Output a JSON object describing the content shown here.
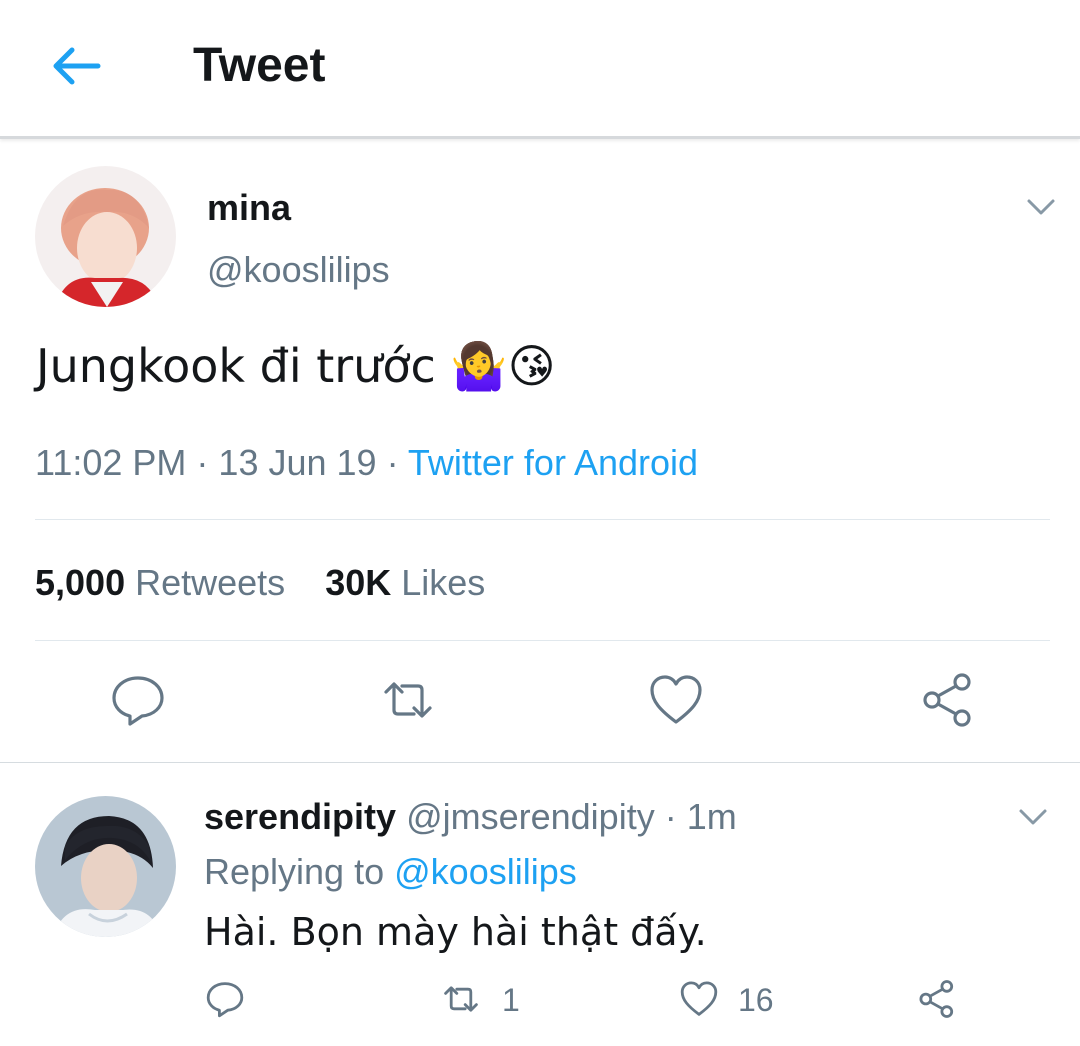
{
  "header": {
    "title": "Tweet"
  },
  "tweet": {
    "name": "mina",
    "handle": "@kooslilips",
    "text": "Jungkook đi trước 🤷‍♀️😘",
    "time": "11:02 PM",
    "date": "13 Jun 19",
    "separator": " · ",
    "source": "Twitter for Android",
    "retweets_count": "5,000",
    "retweets_label": "Retweets",
    "likes_count": "30K",
    "likes_label": "Likes"
  },
  "reply": {
    "name": "serendipity",
    "handle": "@jmserendipity",
    "time": "1m",
    "replying_prefix": "Replying to",
    "replying_handle": "@kooslilips",
    "text": "Hài. Bọn mày hài thật đấy.",
    "retweet_count": "1",
    "like_count": "16"
  },
  "colors": {
    "accent": "#1da1f2",
    "secondary_text": "#657786",
    "action_icons": "#657786"
  },
  "icons": [
    "back-arrow-icon",
    "chevron-down-icon",
    "reply-icon",
    "retweet-icon",
    "heart-icon",
    "share-icon"
  ]
}
